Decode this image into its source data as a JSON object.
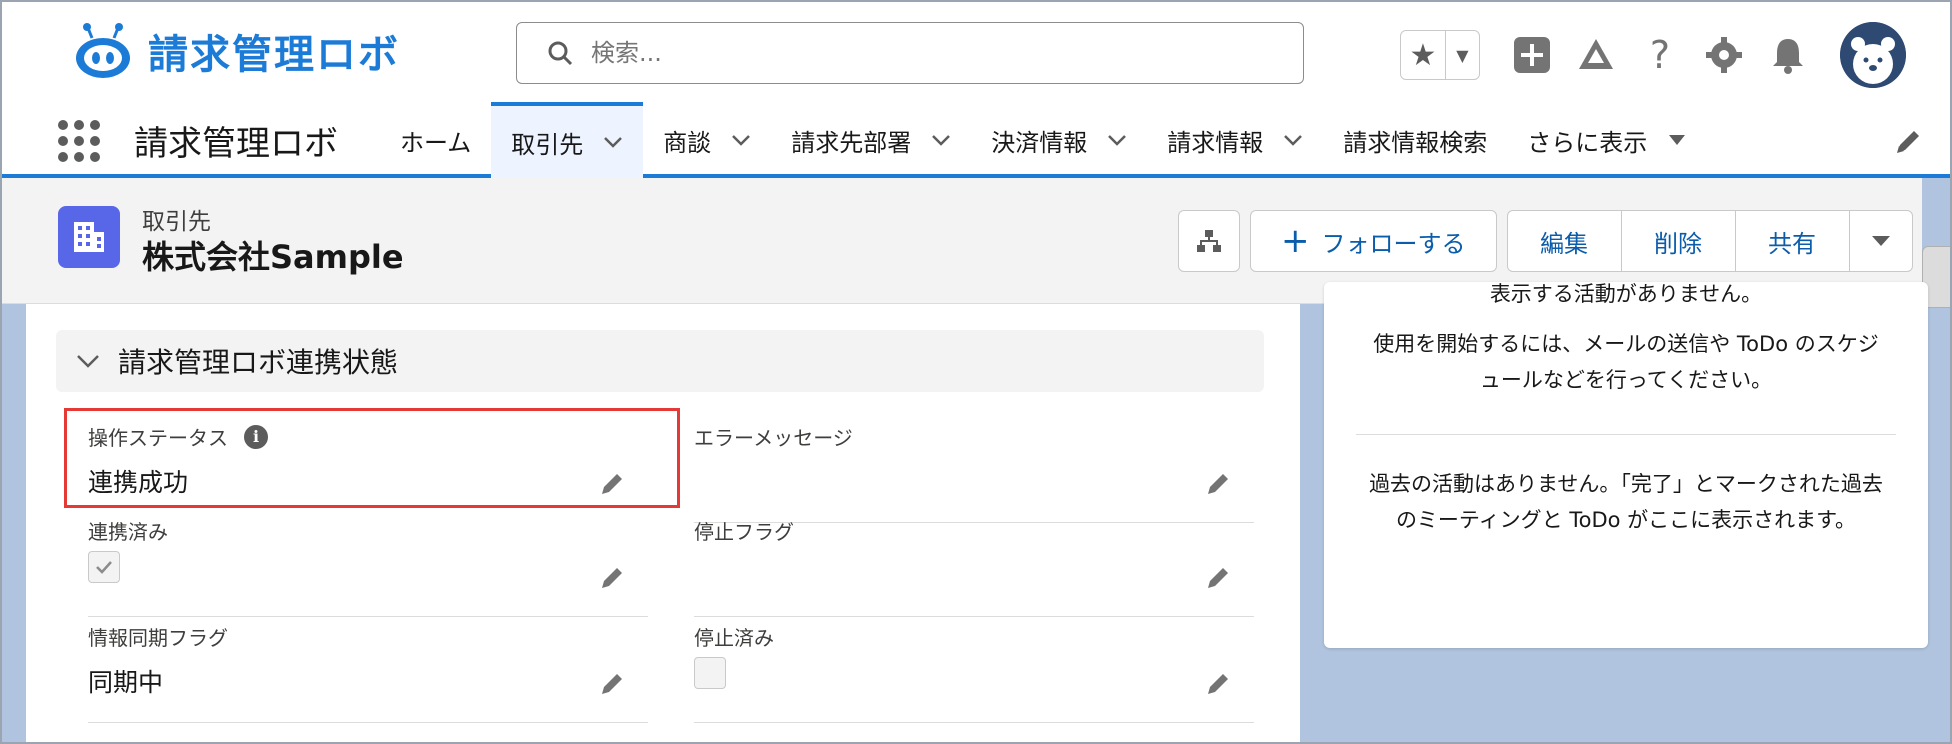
{
  "header": {
    "logo_text": "請求管理ロボ",
    "search_placeholder": "検索..."
  },
  "nav": {
    "app_name": "請求管理ロボ",
    "items": [
      {
        "label": "ホーム",
        "has_menu": false,
        "active": false
      },
      {
        "label": "取引先",
        "has_menu": true,
        "active": true
      },
      {
        "label": "商談",
        "has_menu": true,
        "active": false
      },
      {
        "label": "請求先部署",
        "has_menu": true,
        "active": false
      },
      {
        "label": "決済情報",
        "has_menu": true,
        "active": false
      },
      {
        "label": "請求情報",
        "has_menu": true,
        "active": false
      },
      {
        "label": "請求情報検索",
        "has_menu": false,
        "active": false
      },
      {
        "label": "さらに表示",
        "has_menu": true,
        "active": false
      }
    ]
  },
  "record": {
    "object_type": "取引先",
    "name": "株式会社Sample",
    "actions": {
      "follow": "フォローする",
      "edit": "編集",
      "delete": "削除",
      "share": "共有"
    }
  },
  "section": {
    "title": "請求管理ロボ連携状態",
    "fields": {
      "op_status": {
        "label": "操作ステータス",
        "value": "連携成功"
      },
      "error_message": {
        "label": "エラーメッセージ",
        "value": ""
      },
      "linked": {
        "label": "連携済み",
        "checked": true
      },
      "stop_flag": {
        "label": "停止フラグ",
        "value": ""
      },
      "sync_flag": {
        "label": "情報同期フラグ",
        "value": "同期中"
      },
      "stopped": {
        "label": "停止済み",
        "checked": false
      }
    }
  },
  "activity": {
    "cut_text": "表示する活動がありません。",
    "upcoming_msg_line1": "使用を開始するには、メールの送信や ToDo のスケジ",
    "upcoming_msg_line2": "ュールなどを行ってください。",
    "past_msg_line1": "過去の活動はありません。「完了」とマークされた過去",
    "past_msg_line2": "のミーティングと ToDo がここに表示されます。"
  },
  "colors": {
    "brand": "#1b7bd6",
    "object_icon": "#5867e8",
    "highlight_box": "#e53935",
    "background": "#b0c4df"
  }
}
